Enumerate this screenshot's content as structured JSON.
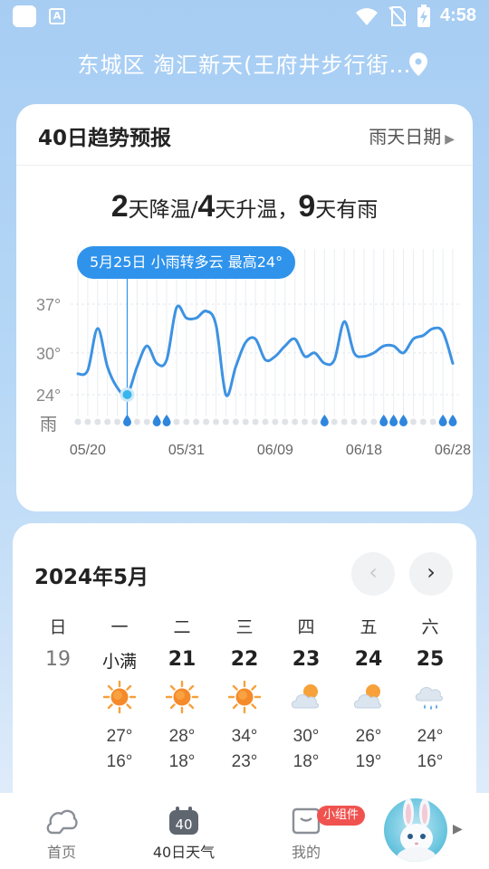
{
  "status_bar": {
    "time": "4:58",
    "a_icon_letter": "A",
    "icons": [
      "app-square-icon",
      "a-notification-icon",
      "wifi-icon",
      "no-sim-icon",
      "battery-charging-icon"
    ]
  },
  "location": {
    "text": "东城区 淘汇新天(王府井步行街…",
    "icon": "location-pin-icon"
  },
  "trend": {
    "title": "40日趋势预报",
    "rain_dates_link": "雨天日期",
    "summary": {
      "cooling_days": "2",
      "cooling_label": "天降温/",
      "warming_days": "4",
      "warming_label": "天升温，",
      "rain_days": "9",
      "rain_label": "天有雨"
    },
    "tooltip": "5月25日 小雨转多云 最高24°",
    "colors": {
      "line": "#3d92e2",
      "highlight": "#2f93ec"
    }
  },
  "chart_data": {
    "type": "line",
    "title": "",
    "xlabel": "",
    "ylabel": "",
    "y_ticks": [
      "37°",
      "30°",
      "24°"
    ],
    "y_tick_values": [
      37,
      30,
      24
    ],
    "ylim": [
      20,
      40
    ],
    "x_ticks": [
      "05/20",
      "05/31",
      "06/09",
      "06/18",
      "06/28"
    ],
    "x_tick_index": [
      1,
      11,
      20,
      29,
      38
    ],
    "rain_row_label": "雨",
    "selected_index": 5,
    "series": [
      {
        "values": [
          27,
          27.5,
          33.5,
          28,
          25,
          24,
          28,
          31,
          28.5,
          29,
          36.5,
          35,
          35,
          36,
          34,
          24,
          28,
          31.5,
          32,
          29,
          29.5,
          31,
          32,
          29.5,
          30,
          28.5,
          29,
          34.5,
          30,
          29.5,
          30,
          31,
          31,
          30,
          32,
          32.5,
          33.5,
          33,
          28.5
        ]
      }
    ],
    "rain_days_index": [
      5,
      8,
      9,
      25,
      31,
      32,
      33,
      37,
      38
    ],
    "grid": true
  },
  "calendar": {
    "title": "2024年5月",
    "prev_icon": "chevron-left-icon",
    "next_icon": "chevron-right-icon",
    "weekdays": [
      "日",
      "一",
      "二",
      "三",
      "四",
      "五",
      "六"
    ],
    "days": [
      {
        "day": "19",
        "icon": "",
        "high": "",
        "low": ""
      },
      {
        "day": "小满",
        "icon": "sunny-icon",
        "high": "27°",
        "low": "16°"
      },
      {
        "day": "21",
        "icon": "sunny-icon",
        "high": "28°",
        "low": "18°"
      },
      {
        "day": "22",
        "icon": "sunny-icon",
        "high": "34°",
        "low": "23°"
      },
      {
        "day": "23",
        "icon": "partly-cloudy-icon",
        "high": "30°",
        "low": "18°"
      },
      {
        "day": "24",
        "icon": "partly-cloudy-icon",
        "high": "26°",
        "low": "19°"
      },
      {
        "day": "25",
        "icon": "rain-icon",
        "high": "24°",
        "low": "16°"
      }
    ]
  },
  "bottom_nav": {
    "home_label": "首页",
    "forty_label": "40日天气",
    "forty_icon_text": "40",
    "mine_label": "我的",
    "widget_badge": "小组件",
    "avatar_icon": "bunny-avatar-icon",
    "more_icon": "triangle-right-icon"
  }
}
